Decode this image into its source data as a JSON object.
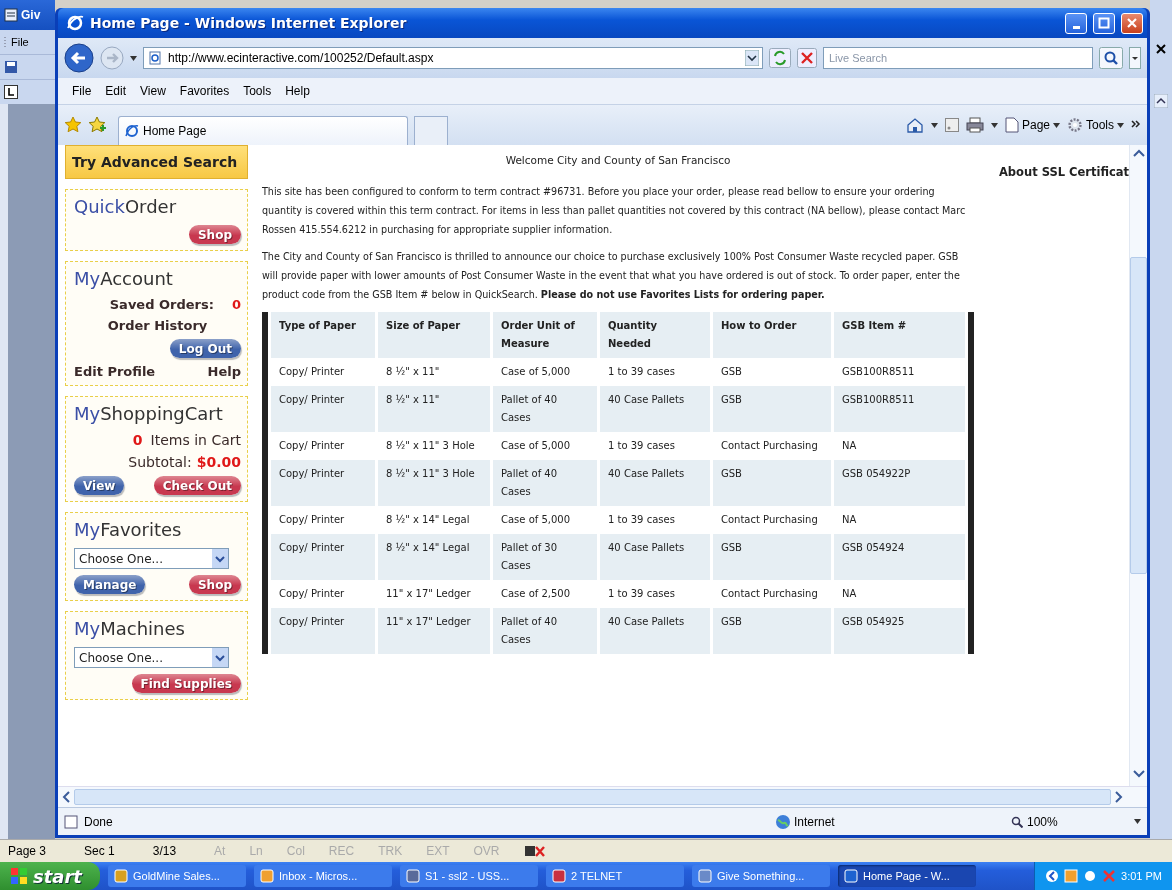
{
  "background_app": {
    "title": "Giv",
    "menu": [
      "File"
    ]
  },
  "window": {
    "title": "Home Page - Windows Internet Explorer"
  },
  "address_bar": {
    "url": "http://www.ecinteractive.com/100252/Default.aspx"
  },
  "search": {
    "placeholder": "Live Search"
  },
  "menu": [
    "File",
    "Edit",
    "View",
    "Favorites",
    "Tools",
    "Help"
  ],
  "tabs": [
    {
      "label": "Home Page",
      "selected": true
    }
  ],
  "command_bar": [
    "Page",
    "Tools"
  ],
  "sidebar": {
    "advanced_search": "Try Advanced Search",
    "boxes": [
      {
        "title_parts": [
          "Quick",
          "Order"
        ],
        "rows": [
          {
            "kind": "buttons",
            "buttons": [
              {
                "label": "Shop",
                "color": "#c8384f"
              }
            ]
          }
        ]
      },
      {
        "title_parts": [
          "My",
          "Account"
        ],
        "rows": [
          {
            "kind": "stat",
            "label": "Saved Orders:",
            "value": "0"
          },
          {
            "kind": "link",
            "label": "Order History"
          },
          {
            "kind": "buttons",
            "buttons": [
              {
                "label": "Log Out",
                "color": "#3f63ab"
              }
            ]
          },
          {
            "kind": "links",
            "links": [
              "Edit Profile",
              "Help"
            ]
          }
        ]
      },
      {
        "title_parts": [
          "My",
          "ShoppingCart"
        ],
        "rows": [
          {
            "kind": "count",
            "value": "0",
            "label": "Items in Cart"
          },
          {
            "kind": "total",
            "label": "Subtotal:",
            "value": "$0.00"
          },
          {
            "kind": "buttons",
            "buttons": [
              {
                "label": "View",
                "color": "#3f63ab"
              },
              {
                "label": "Check Out",
                "color": "#c8384f"
              }
            ]
          }
        ]
      },
      {
        "title_parts": [
          "My",
          "Favorites"
        ],
        "rows": [
          {
            "kind": "select",
            "value": "Choose One..."
          },
          {
            "kind": "buttons",
            "buttons": [
              {
                "label": "Manage",
                "color": "#3f63ab"
              },
              {
                "label": "Shop",
                "color": "#c8384f"
              }
            ]
          }
        ]
      },
      {
        "title_parts": [
          "My",
          "Machines"
        ],
        "rows": [
          {
            "kind": "select",
            "value": "Choose One..."
          },
          {
            "kind": "buttons",
            "buttons": [
              {
                "label": "Find Supplies",
                "color": "#c8384f"
              }
            ]
          }
        ]
      }
    ]
  },
  "page": {
    "welcome": "Welcome City and County of San Francisco",
    "paragraphs": [
      "This site has been configured to conform to term contract #96731. Before you place your order, please read bellow to ensure your ordering quantity is covered within this term contract. For items in less than pallet quantities not covered by this contract (NA bellow), please contact Marc Rossen 415.554.6212 in purchasing for appropriate supplier information.",
      "The City and County of San Francisco is thrilled to announce our choice to purchase exclusively 100% Post Consumer Waste recycled paper. GSB will provide paper with lower amounts of Post Consumer Waste in the event that what you have ordered is out of stock. To order paper, enter the product code from the GSB Item # below in QuickSearch. **Please do not use Favorites Lists for ordering paper.**"
    ],
    "ssl_link": "About SSL Certificat"
  },
  "table": {
    "columns": [
      "Type of Paper",
      "Size of Paper",
      "Order Unit of Measure",
      "Quantity Needed",
      "How to Order",
      "GSB Item #"
    ],
    "rows": [
      [
        "Copy/ Printer",
        "8 ½\" x 11\"",
        "Case of 5,000",
        "1 to 39 cases",
        "GSB",
        "GSB100R8511"
      ],
      [
        "Copy/ Printer",
        "8 ½\" x 11\"",
        "Pallet of 40 Cases",
        "40 Case Pallets",
        "GSB",
        "GSB100R8511"
      ],
      [
        "Copy/ Printer",
        "8 ½\" x 11\" 3 Hole",
        "Case of 5,000",
        "1 to 39 cases",
        "Contact Purchasing",
        "NA"
      ],
      [
        "Copy/ Printer",
        "8 ½\" x 11\" 3 Hole",
        "Pallet of 40 Cases",
        "40 Case Pallets",
        "GSB",
        "GSB 054922P"
      ],
      [
        "Copy/ Printer",
        "8 ½\" x 14\" Legal",
        "Case of 5,000",
        "1 to 39 cases",
        "Contact Purchasing",
        "NA"
      ],
      [
        "Copy/ Printer",
        "8 ½\" x 14\" Legal",
        "Pallet of 30 Cases",
        "40 Case Pallets",
        "GSB",
        "GSB 054924"
      ],
      [
        "Copy/ Printer",
        "11\" x 17\" Ledger",
        "Case of 2,500",
        "1 to 39 cases",
        "Contact Purchasing",
        "NA"
      ],
      [
        "Copy/ Printer",
        "11\" x 17\" Ledger",
        "Pallet of 40 Cases",
        "40 Case Pallets",
        "GSB",
        "GSB 054925"
      ]
    ]
  },
  "status_bar": {
    "text": "Done",
    "zone": "Internet",
    "zoom": "100%"
  },
  "word_status": [
    {
      "text": "Page 3",
      "dimmed": false
    },
    {
      "text": "Sec 1",
      "dimmed": false
    },
    {
      "text": "3/13",
      "dimmed": false
    },
    {
      "text": "At",
      "dimmed": true
    },
    {
      "text": "Ln",
      "dimmed": true
    },
    {
      "text": "Col",
      "dimmed": true
    },
    {
      "text": "REC",
      "dimmed": true
    },
    {
      "text": "TRK",
      "dimmed": true
    },
    {
      "text": "EXT",
      "dimmed": true
    },
    {
      "text": "OVR",
      "dimmed": true
    }
  ],
  "taskbar": {
    "start": "start",
    "tasks": [
      {
        "label": "GoldMine Sales...",
        "selected": false
      },
      {
        "label": "Inbox - Micros...",
        "selected": false
      },
      {
        "label": "S1 - ssl2 - USS...",
        "selected": false
      },
      {
        "label": "2 TELNET",
        "selected": false
      },
      {
        "label": "Give Something...",
        "selected": false
      },
      {
        "label": "Home Page - W...",
        "selected": true
      }
    ],
    "clock": "3:01 PM"
  }
}
